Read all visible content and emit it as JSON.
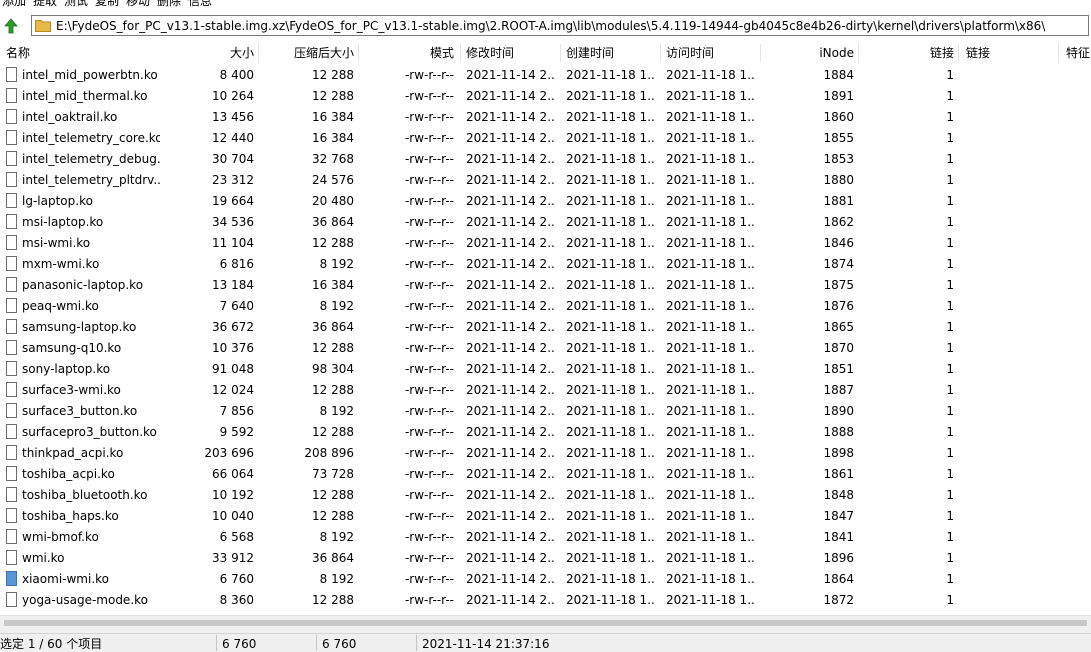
{
  "toolbar": {
    "items": [
      "添加",
      "提取",
      "测试",
      "复制",
      "移动",
      "删除",
      "信息"
    ]
  },
  "path": {
    "value": "E:\\FydeOS_for_PC_v13.1-stable.img.xz\\FydeOS_for_PC_v13.1-stable.img\\2.ROOT-A.img\\lib\\modules\\5.4.119-14944-gb4045c8e4b26-dirty\\kernel\\drivers\\platform\\x86\\"
  },
  "columns": [
    "名称",
    "大小",
    "压缩后大小",
    "模式",
    "修改时间",
    "创建时间",
    "访问时间",
    "iNode",
    "链接",
    "链接",
    "特征"
  ],
  "files": [
    {
      "name": "intel_mid_powerbtn.ko",
      "size": "8 400",
      "packed": "12 288",
      "mode": "-rw-r--r--",
      "mtime": "2021-11-14 2...",
      "ctime": "2021-11-18 1...",
      "atime": "2021-11-18 1...",
      "inode": "1884",
      "links": "1",
      "selected": false
    },
    {
      "name": "intel_mid_thermal.ko",
      "size": "10 264",
      "packed": "12 288",
      "mode": "-rw-r--r--",
      "mtime": "2021-11-14 2...",
      "ctime": "2021-11-18 1...",
      "atime": "2021-11-18 1...",
      "inode": "1891",
      "links": "1",
      "selected": false
    },
    {
      "name": "intel_oaktrail.ko",
      "size": "13 456",
      "packed": "16 384",
      "mode": "-rw-r--r--",
      "mtime": "2021-11-14 2...",
      "ctime": "2021-11-18 1...",
      "atime": "2021-11-18 1...",
      "inode": "1860",
      "links": "1",
      "selected": false
    },
    {
      "name": "intel_telemetry_core.ko",
      "size": "12 440",
      "packed": "16 384",
      "mode": "-rw-r--r--",
      "mtime": "2021-11-14 2...",
      "ctime": "2021-11-18 1...",
      "atime": "2021-11-18 1...",
      "inode": "1855",
      "links": "1",
      "selected": false
    },
    {
      "name": "intel_telemetry_debug...",
      "size": "30 704",
      "packed": "32 768",
      "mode": "-rw-r--r--",
      "mtime": "2021-11-14 2...",
      "ctime": "2021-11-18 1...",
      "atime": "2021-11-18 1...",
      "inode": "1853",
      "links": "1",
      "selected": false
    },
    {
      "name": "intel_telemetry_pltdrv....",
      "size": "23 312",
      "packed": "24 576",
      "mode": "-rw-r--r--",
      "mtime": "2021-11-14 2...",
      "ctime": "2021-11-18 1...",
      "atime": "2021-11-18 1...",
      "inode": "1880",
      "links": "1",
      "selected": false
    },
    {
      "name": "lg-laptop.ko",
      "size": "19 664",
      "packed": "20 480",
      "mode": "-rw-r--r--",
      "mtime": "2021-11-14 2...",
      "ctime": "2021-11-18 1...",
      "atime": "2021-11-18 1...",
      "inode": "1881",
      "links": "1",
      "selected": false
    },
    {
      "name": "msi-laptop.ko",
      "size": "34 536",
      "packed": "36 864",
      "mode": "-rw-r--r--",
      "mtime": "2021-11-14 2...",
      "ctime": "2021-11-18 1...",
      "atime": "2021-11-18 1...",
      "inode": "1862",
      "links": "1",
      "selected": false
    },
    {
      "name": "msi-wmi.ko",
      "size": "11 104",
      "packed": "12 288",
      "mode": "-rw-r--r--",
      "mtime": "2021-11-14 2...",
      "ctime": "2021-11-18 1...",
      "atime": "2021-11-18 1...",
      "inode": "1846",
      "links": "1",
      "selected": false
    },
    {
      "name": "mxm-wmi.ko",
      "size": "6 816",
      "packed": "8 192",
      "mode": "-rw-r--r--",
      "mtime": "2021-11-14 2...",
      "ctime": "2021-11-18 1...",
      "atime": "2021-11-18 1...",
      "inode": "1874",
      "links": "1",
      "selected": false
    },
    {
      "name": "panasonic-laptop.ko",
      "size": "13 184",
      "packed": "16 384",
      "mode": "-rw-r--r--",
      "mtime": "2021-11-14 2...",
      "ctime": "2021-11-18 1...",
      "atime": "2021-11-18 1...",
      "inode": "1875",
      "links": "1",
      "selected": false
    },
    {
      "name": "peaq-wmi.ko",
      "size": "7 640",
      "packed": "8 192",
      "mode": "-rw-r--r--",
      "mtime": "2021-11-14 2...",
      "ctime": "2021-11-18 1...",
      "atime": "2021-11-18 1...",
      "inode": "1876",
      "links": "1",
      "selected": false
    },
    {
      "name": "samsung-laptop.ko",
      "size": "36 672",
      "packed": "36 864",
      "mode": "-rw-r--r--",
      "mtime": "2021-11-14 2...",
      "ctime": "2021-11-18 1...",
      "atime": "2021-11-18 1...",
      "inode": "1865",
      "links": "1",
      "selected": false
    },
    {
      "name": "samsung-q10.ko",
      "size": "10 376",
      "packed": "12 288",
      "mode": "-rw-r--r--",
      "mtime": "2021-11-14 2...",
      "ctime": "2021-11-18 1...",
      "atime": "2021-11-18 1...",
      "inode": "1870",
      "links": "1",
      "selected": false
    },
    {
      "name": "sony-laptop.ko",
      "size": "91 048",
      "packed": "98 304",
      "mode": "-rw-r--r--",
      "mtime": "2021-11-14 2...",
      "ctime": "2021-11-18 1...",
      "atime": "2021-11-18 1...",
      "inode": "1851",
      "links": "1",
      "selected": false
    },
    {
      "name": "surface3-wmi.ko",
      "size": "12 024",
      "packed": "12 288",
      "mode": "-rw-r--r--",
      "mtime": "2021-11-14 2...",
      "ctime": "2021-11-18 1...",
      "atime": "2021-11-18 1...",
      "inode": "1887",
      "links": "1",
      "selected": false
    },
    {
      "name": "surface3_button.ko",
      "size": "7 856",
      "packed": "8 192",
      "mode": "-rw-r--r--",
      "mtime": "2021-11-14 2...",
      "ctime": "2021-11-18 1...",
      "atime": "2021-11-18 1...",
      "inode": "1890",
      "links": "1",
      "selected": false
    },
    {
      "name": "surfacepro3_button.ko",
      "size": "9 592",
      "packed": "12 288",
      "mode": "-rw-r--r--",
      "mtime": "2021-11-14 2...",
      "ctime": "2021-11-18 1...",
      "atime": "2021-11-18 1...",
      "inode": "1888",
      "links": "1",
      "selected": false
    },
    {
      "name": "thinkpad_acpi.ko",
      "size": "203 696",
      "packed": "208 896",
      "mode": "-rw-r--r--",
      "mtime": "2021-11-14 2...",
      "ctime": "2021-11-18 1...",
      "atime": "2021-11-18 1...",
      "inode": "1898",
      "links": "1",
      "selected": false
    },
    {
      "name": "toshiba_acpi.ko",
      "size": "66 064",
      "packed": "73 728",
      "mode": "-rw-r--r--",
      "mtime": "2021-11-14 2...",
      "ctime": "2021-11-18 1...",
      "atime": "2021-11-18 1...",
      "inode": "1861",
      "links": "1",
      "selected": false
    },
    {
      "name": "toshiba_bluetooth.ko",
      "size": "10 192",
      "packed": "12 288",
      "mode": "-rw-r--r--",
      "mtime": "2021-11-14 2...",
      "ctime": "2021-11-18 1...",
      "atime": "2021-11-18 1...",
      "inode": "1848",
      "links": "1",
      "selected": false
    },
    {
      "name": "toshiba_haps.ko",
      "size": "10 040",
      "packed": "12 288",
      "mode": "-rw-r--r--",
      "mtime": "2021-11-14 2...",
      "ctime": "2021-11-18 1...",
      "atime": "2021-11-18 1...",
      "inode": "1847",
      "links": "1",
      "selected": false
    },
    {
      "name": "wmi-bmof.ko",
      "size": "6 568",
      "packed": "8 192",
      "mode": "-rw-r--r--",
      "mtime": "2021-11-14 2...",
      "ctime": "2021-11-18 1...",
      "atime": "2021-11-18 1...",
      "inode": "1841",
      "links": "1",
      "selected": false
    },
    {
      "name": "wmi.ko",
      "size": "33 912",
      "packed": "36 864",
      "mode": "-rw-r--r--",
      "mtime": "2021-11-14 2...",
      "ctime": "2021-11-18 1...",
      "atime": "2021-11-18 1...",
      "inode": "1896",
      "links": "1",
      "selected": false
    },
    {
      "name": "xiaomi-wmi.ko",
      "size": "6 760",
      "packed": "8 192",
      "mode": "-rw-r--r--",
      "mtime": "2021-11-14 2...",
      "ctime": "2021-11-18 1...",
      "atime": "2021-11-18 1...",
      "inode": "1864",
      "links": "1",
      "selected": true
    },
    {
      "name": "yoga-usage-mode.ko",
      "size": "8 360",
      "packed": "12 288",
      "mode": "-rw-r--r--",
      "mtime": "2021-11-14 2...",
      "ctime": "2021-11-18 1...",
      "atime": "2021-11-18 1...",
      "inode": "1872",
      "links": "1",
      "selected": false
    }
  ],
  "status": {
    "selection": "选定 1 / 60 个项目",
    "size": "6 760",
    "packed": "6 760",
    "mtime": "2021-11-14 21:37:16"
  },
  "colors": {
    "folder": "#e8b84a",
    "up_arrow": "#2e9a2e",
    "selected_icon": "#5a95d6"
  }
}
